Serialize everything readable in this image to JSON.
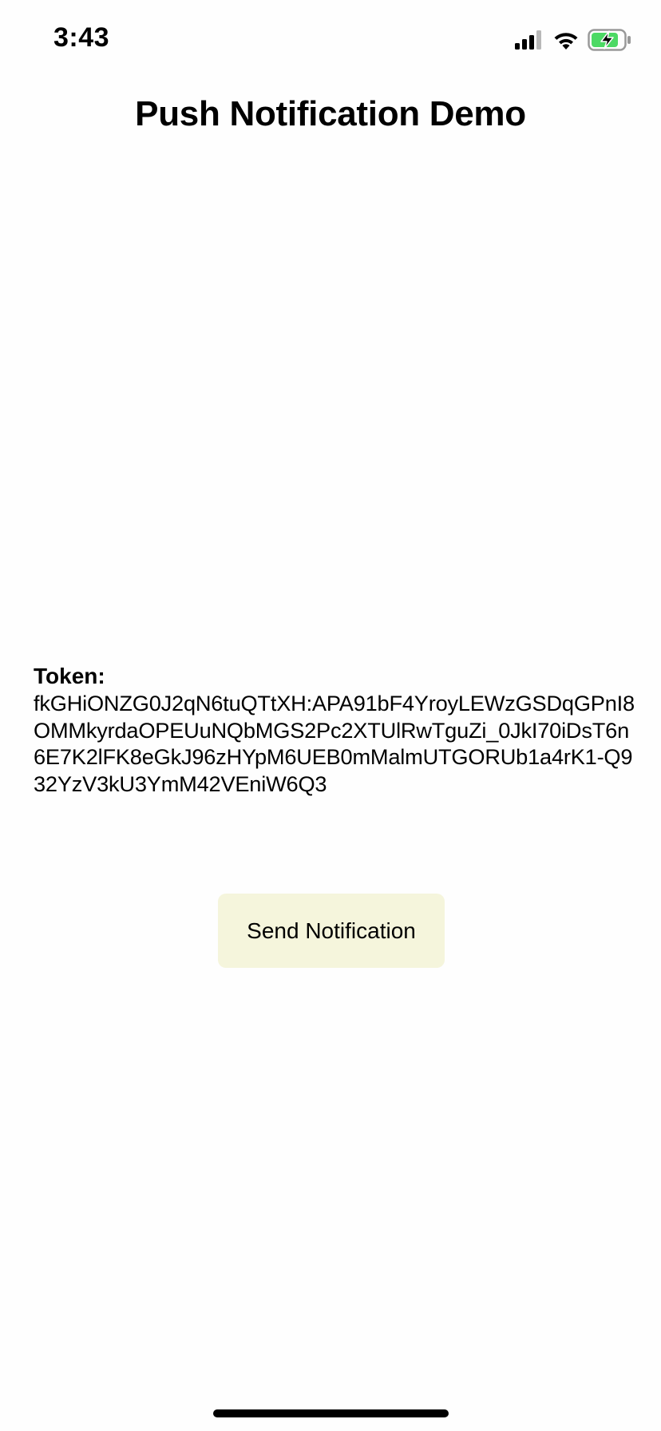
{
  "status_bar": {
    "time": "3:43",
    "icons": [
      "cellular-signal-icon",
      "wifi-icon",
      "battery-charging-icon"
    ],
    "battery_color": "#4cd964"
  },
  "header": {
    "title": "Push Notification Demo"
  },
  "token": {
    "label": "Token:",
    "value": "fkGHiONZG0J2qN6tuQTtXH:APA91bF4YroyLEWzGSDqGPnI8OMMkyrdaOPEUuNQbMGS2Pc2XTUlRwTguZi_0JkI70iDsT6n6E7K2lFK8eGkJ96zHYpM6UEB0mMalmUTGORUb1a4rK1-Q932YzV3kU3YmM42VEniW6Q3"
  },
  "actions": {
    "send_label": "Send Notification",
    "button_color": "#f5f5dc"
  }
}
